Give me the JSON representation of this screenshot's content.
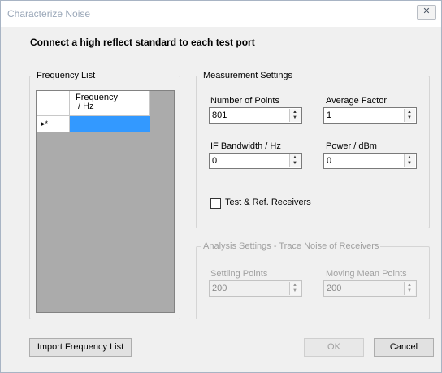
{
  "window": {
    "title": "Characterize Noise",
    "close_glyph": "✕"
  },
  "instruction": "Connect a high reflect standard to each test port",
  "frequency_list": {
    "legend": "Frequency List",
    "column_header": "Frequency\n / Hz",
    "new_row_marker": "▸*"
  },
  "measurement": {
    "legend": "Measurement Settings",
    "number_of_points": {
      "label": "Number of Points",
      "value": "801"
    },
    "average_factor": {
      "label": "Average Factor",
      "value": "1"
    },
    "if_bandwidth": {
      "label": "IF Bandwidth / Hz",
      "value": "0"
    },
    "power": {
      "label": "Power / dBm",
      "value": "0"
    },
    "receivers_checkbox": {
      "label": "Test & Ref. Receivers",
      "checked": false
    }
  },
  "analysis": {
    "legend": "Analysis Settings - Trace Noise of Receivers",
    "settling_points": {
      "label": "Settling Points",
      "value": "200"
    },
    "moving_mean_points": {
      "label": "Moving Mean Points",
      "value": "200"
    }
  },
  "buttons": {
    "import": "Import Frequency List",
    "ok": "OK",
    "cancel": "Cancel"
  },
  "icons": {
    "spin_up": "▲",
    "spin_down": "▼"
  }
}
